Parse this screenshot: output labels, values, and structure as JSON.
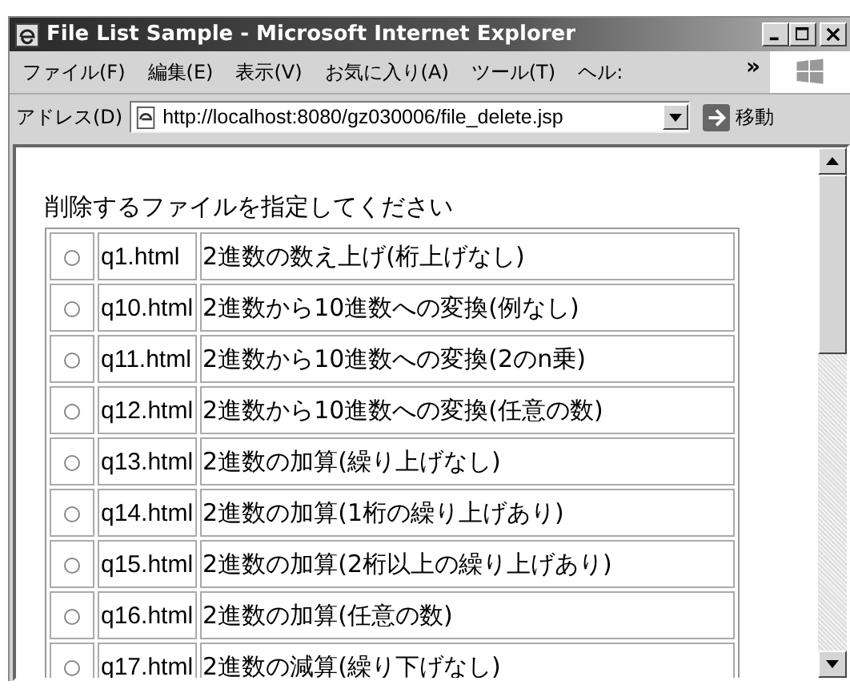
{
  "window": {
    "title": "File List Sample - Microsoft Internet Explorer"
  },
  "menu": [
    {
      "label": "ファイル(F)"
    },
    {
      "label": "編集(E)"
    },
    {
      "label": "表示(V)"
    },
    {
      "label": "お気に入り(A)"
    },
    {
      "label": "ツール(T)"
    },
    {
      "label": "ヘル:"
    }
  ],
  "menu_overflow": "»",
  "address_bar": {
    "label": "アドレス(D)",
    "value": "http://localhost:8080/gz030006/file_delete.jsp",
    "go_label": "移動"
  },
  "page": {
    "heading": "削除するファイルを指定してください",
    "rows": [
      {
        "file": "q1.html",
        "description": "2進数の数え上げ(桁上げなし)",
        "selected": false
      },
      {
        "file": "q10.html",
        "description": "2進数から10進数への変換(例なし)",
        "selected": false
      },
      {
        "file": "q11.html",
        "description": "2進数から10進数への変換(2のn乗)",
        "selected": false
      },
      {
        "file": "q12.html",
        "description": "2進数から10進数への変換(任意の数)",
        "selected": false
      },
      {
        "file": "q13.html",
        "description": "2進数の加算(繰り上げなし)",
        "selected": false
      },
      {
        "file": "q14.html",
        "description": "2進数の加算(1桁の繰り上げあり)",
        "selected": false
      },
      {
        "file": "q15.html",
        "description": "2進数の加算(2桁以上の繰り上げあり)",
        "selected": false
      },
      {
        "file": "q16.html",
        "description": "2進数の加算(任意の数)",
        "selected": false
      },
      {
        "file": "q17.html",
        "description": "2進数の減算(繰り下げなし)",
        "selected": false
      }
    ]
  }
}
